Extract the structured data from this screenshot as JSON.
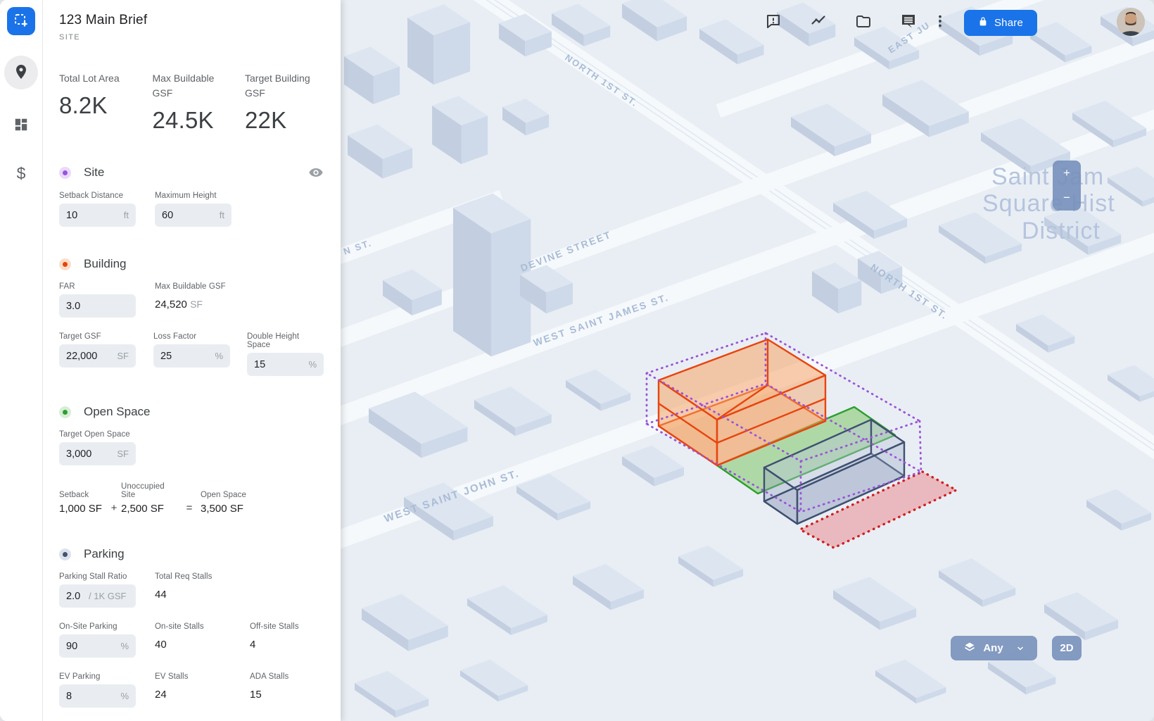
{
  "window": {
    "title": "123 Main Brief",
    "subtitle": "SITE"
  },
  "rail": {
    "currency_label": "$"
  },
  "metrics": [
    {
      "label": "Total Lot Area",
      "value": "8.2K"
    },
    {
      "label": "Max Buildable GSF",
      "value": "24.5K"
    },
    {
      "label": "Target Building GSF",
      "value": "22K"
    }
  ],
  "sections": {
    "site": {
      "title": "Site",
      "setback": {
        "label": "Setback Distance",
        "value": "10",
        "unit": "ft"
      },
      "max_height": {
        "label": "Maximum Height",
        "value": "60",
        "unit": "ft"
      }
    },
    "building": {
      "title": "Building",
      "far": {
        "label": "FAR",
        "value": "3.0"
      },
      "max_gsf": {
        "label": "Max Buildable GSF",
        "value": "24,520",
        "unit": "SF"
      },
      "target_gsf": {
        "label": "Target GSF",
        "value": "22,000",
        "unit": "SF"
      },
      "loss_factor": {
        "label": "Loss Factor",
        "value": "25",
        "unit": "%"
      },
      "double_height": {
        "label": "Double Height Space",
        "value": "15",
        "unit": "%"
      }
    },
    "open_space": {
      "title": "Open Space",
      "target": {
        "label": "Target Open Space",
        "value": "3,000",
        "unit": "SF"
      },
      "formula": {
        "setback_label": "Setback",
        "setback_value": "1,000 SF",
        "plus": "+",
        "unoccupied_label": "Unoccupied Site",
        "unoccupied_value": "2,500 SF",
        "equals": "=",
        "open_label": "Open Space",
        "open_value": "3,500 SF"
      }
    },
    "parking": {
      "title": "Parking",
      "stall_ratio": {
        "label": "Parking Stall Ratio",
        "value": "2.0",
        "unit": "/ 1K GSF"
      },
      "total_req": {
        "label": "Total Req Stalls",
        "value": "44"
      },
      "onsite_pct": {
        "label": "On-Site Parking",
        "value": "90",
        "unit": "%"
      },
      "onsite_stalls": {
        "label": "On-site Stalls",
        "value": "40"
      },
      "offsite_stalls": {
        "label": "Off-site Stalls",
        "value": "4"
      },
      "ev_pct": {
        "label": "EV Parking",
        "value": "8",
        "unit": "%"
      },
      "ev_stalls": {
        "label": "EV Stalls",
        "value": "24"
      },
      "ada_stalls": {
        "label": "ADA Stalls",
        "value": "15"
      }
    }
  },
  "toolbar": {
    "share_label": "Share",
    "icons": [
      "feedback-icon",
      "analytics-icon",
      "folder-icon",
      "comments-icon",
      "more-options-icon"
    ]
  },
  "map": {
    "streets": [
      "NORTH 1ST ST.",
      "DEVINE STREET",
      "WEST SAINT JAMES ST.",
      "WEST SAINT JOHN ST.",
      "NORTH 1ST ST.",
      "N ST.",
      "EAST JU"
    ],
    "district": [
      "Saint Jam",
      "Square Hist",
      "District"
    ],
    "controls": {
      "zoom_in": "+",
      "zoom_out": "−",
      "layers_label": "Any",
      "view_toggle": "2D"
    }
  },
  "colors": {
    "accent_blue": "#1a73e8",
    "site_purple": "#9a55d6",
    "building_orange": "#e8440e",
    "open_space_green": "#2f9e2f",
    "parking_navy": "#3f5070",
    "offsite_red": "#cf1f1f"
  }
}
